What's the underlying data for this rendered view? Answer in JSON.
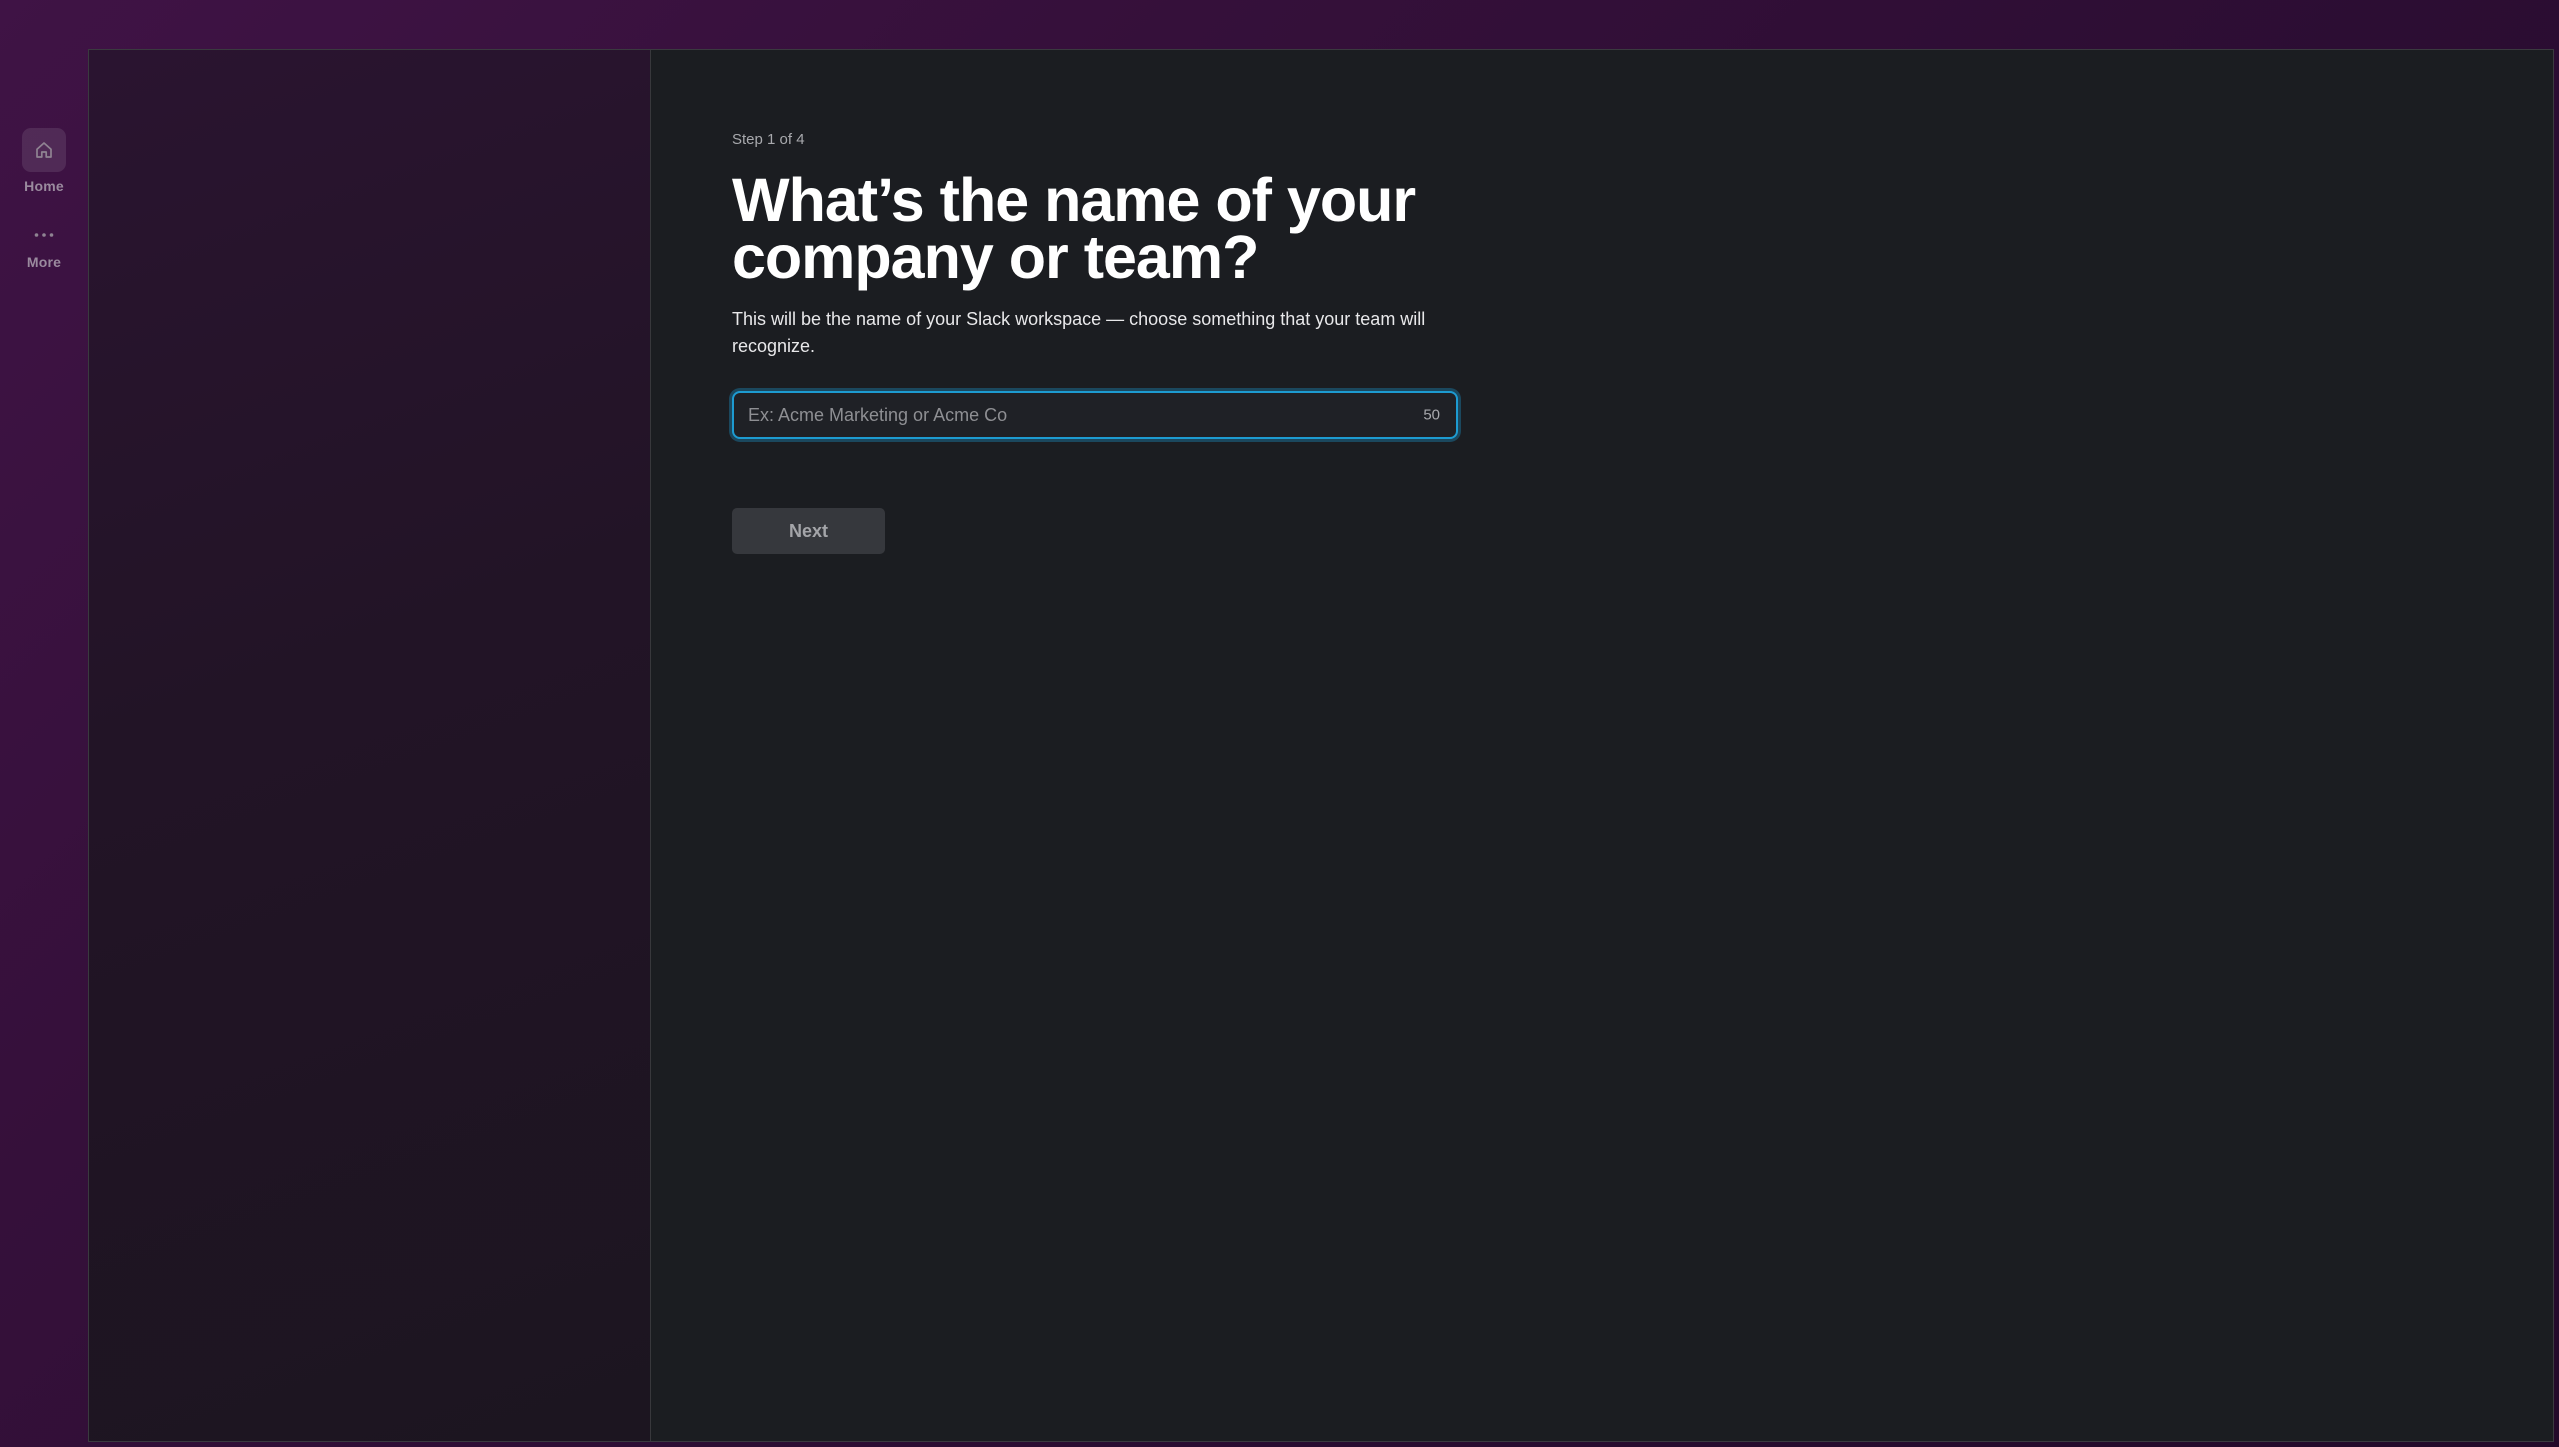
{
  "nav": {
    "items": [
      {
        "label": "Home",
        "icon": "home-icon"
      },
      {
        "label": "More",
        "icon": "more-horizontal-icon"
      }
    ]
  },
  "setup": {
    "step_text": "Step 1 of 4",
    "title": "What’s the name of your company or team?",
    "description": "This will be the name of your Slack workspace — choose something that your team will recognize.",
    "input": {
      "value": "",
      "placeholder": "Ex: Acme Marketing or Acme Co",
      "remaining_chars": "50"
    },
    "next_label": "Next"
  },
  "colors": {
    "background": "#3f1345",
    "panel": "#1b1d21",
    "focus_ring": "#1d9bd1",
    "button": "#36383d"
  }
}
